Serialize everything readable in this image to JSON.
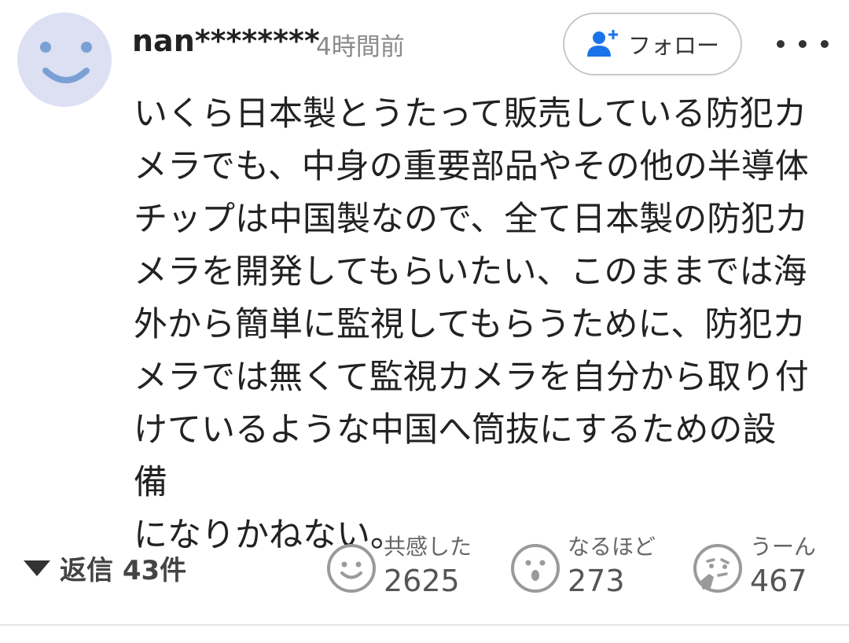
{
  "comment": {
    "username": "nan********",
    "timestamp": "4時間前",
    "follow_label": "フォロー",
    "body": "いくら日本製とうたって販売している防犯カ\nメラでも、中身の重要部品やその他の半導体\nチップは中国製なので、全て日本製の防犯カ\nメラを開発してもらいたい、このままでは海\n外から簡単に監視してもらうために、防犯カ\nメラでは無くて監視カメラを自分から取り付\nけているような中国へ筒抜にするための設備\nになりかねない。"
  },
  "replies": {
    "label": "返信 43件"
  },
  "reactions": [
    {
      "label": "共感した",
      "count": "2625",
      "icon": "smile-icon"
    },
    {
      "label": "なるほど",
      "count": "273",
      "icon": "surprised-icon"
    },
    {
      "label": "うーん",
      "count": "467",
      "icon": "thinking-icon"
    }
  ],
  "colors": {
    "avatar_bg": "#dde0f2",
    "avatar_face": "#7aa0d6",
    "follow_icon": "#1a73e8",
    "reaction_icon": "#9a9a9a"
  }
}
